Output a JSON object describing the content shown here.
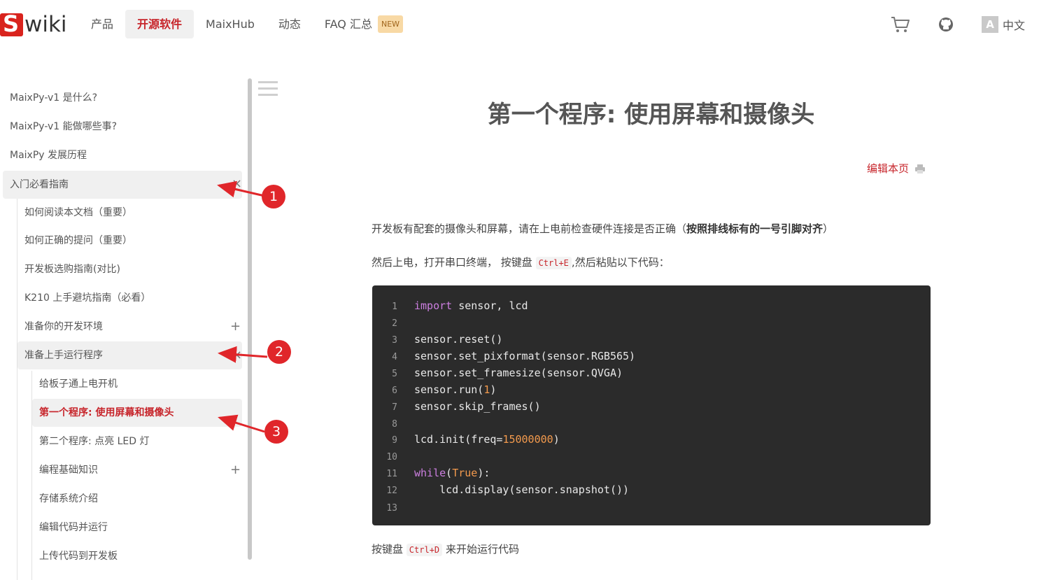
{
  "header": {
    "logo_mark": "S",
    "logo_text": "wiki",
    "nav": [
      "产品",
      "开源软件",
      "MaixHub",
      "动态",
      "FAQ 汇总"
    ],
    "active_nav": "开源软件",
    "new_badge": "NEW",
    "lang_icon": "A",
    "lang_label": "中文",
    "icons": [
      "cart-icon",
      "github-icon",
      "translate-icon"
    ]
  },
  "sidebar": {
    "items": [
      {
        "label": "MaixPy-v1 是什么?"
      },
      {
        "label": "MaixPy-v1 能做哪些事?"
      },
      {
        "label": "MaixPy 发展历程"
      },
      {
        "label": "入门必看指南",
        "mark": "×"
      },
      {
        "label": "如何阅读本文档（重要）"
      },
      {
        "label": "如何正确的提问（重要）"
      },
      {
        "label": "开发板选购指南(对比)"
      },
      {
        "label": "K210 上手避坑指南（必看）"
      },
      {
        "label": "准备你的开发环境",
        "mark": "+"
      },
      {
        "label": "准备上手运行程序",
        "mark": "×"
      },
      {
        "label": "给板子通上电开机"
      },
      {
        "label": "第一个程序: 使用屏幕和摄像头"
      },
      {
        "label": "第二个程序: 点亮 LED 灯"
      },
      {
        "label": "编程基础知识",
        "mark": "+"
      },
      {
        "label": "存储系统介绍"
      },
      {
        "label": "编辑代码并运行"
      },
      {
        "label": "上传代码到开发板"
      }
    ]
  },
  "content": {
    "title": "第一个程序: 使用屏幕和摄像头",
    "edit_link": "编辑本页",
    "para1_prefix": "开发板有配套的摄像头和屏幕，请在上电前检查硬件连接是否正确（",
    "para1_bold": "按照排线标有的一号引脚对齐",
    "para1_suffix": "）",
    "para2_prefix": "然后上电，打开串口终端， 按键盘",
    "para2_key": "Ctrl+E",
    "para2_suffix": ",然后粘贴以下代码：",
    "para3_prefix": "按键盘",
    "para3_key": "Ctrl+D",
    "para3_suffix": "来开始运行代码",
    "code_lines": [
      "import sensor, lcd",
      "",
      "sensor.reset()",
      "sensor.set_pixformat(sensor.RGB565)",
      "sensor.set_framesize(sensor.QVGA)",
      "sensor.run(1)",
      "sensor.skip_frames()",
      "",
      "lcd.init(freq=15000000)",
      "",
      "while(True):",
      "    lcd.display(sensor.snapshot())",
      ""
    ]
  },
  "annotations": [
    "1",
    "2",
    "3"
  ],
  "colors": {
    "brand": "#d9231d",
    "active": "#c7252b",
    "code_bg": "#2b2b2b",
    "keyword": "#cc7fe0",
    "number": "#f39a4d"
  }
}
